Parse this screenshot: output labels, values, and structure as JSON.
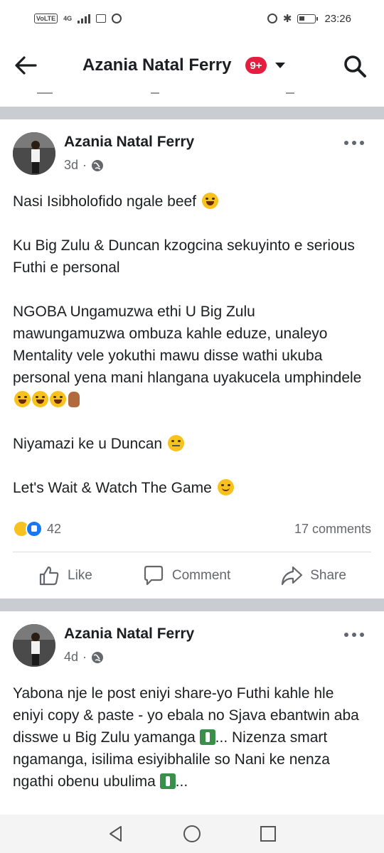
{
  "status_bar": {
    "network_label": "VoLTE",
    "signal_label": "4G",
    "time": "23:26"
  },
  "header": {
    "title": "Azania Natal Ferry",
    "notification_badge": "9+",
    "back_icon": "arrow-left-icon",
    "search_icon": "search-icon"
  },
  "posts": [
    {
      "author": "Azania Natal Ferry",
      "time": "3d",
      "dot": "·",
      "audience_icon": "globe-icon",
      "paragraphs": [
        "Nasi Isibholofido ngale beef",
        "Ku Big Zulu & Duncan kzogcina sekuyinto e serious Futhi e personal",
        "NGOBA Ungamuzwa ethi U Big Zulu mawungamuzwa ombuza kahle eduze, unaleyo Mentality vele yokuthi mawu disse wathi ukuba personal yena mani hlangana uyakucela umphindele",
        "Niyamazi ke u Duncan",
        "Let's Wait & Watch The Game"
      ],
      "reaction_count": "42",
      "comments": "17 comments",
      "actions": {
        "like": "Like",
        "comment": "Comment",
        "share": "Share"
      }
    },
    {
      "author": "Azania Natal Ferry",
      "time": "4d",
      "dot": "·",
      "audience_icon": "globe-icon",
      "text_1": "Yabona nje le post eniyi share-yo Futhi kahle hle eniyi copy & paste - yo ebala no Sjava ebantwin aba disswe u Big Zulu yamanga",
      "text_2": "... Nizenza smart ngamanga, isilima esiyibhalile so Nani ke nenza ngathi obenu ubulima",
      "text_3": "..."
    }
  ],
  "nav_bar": {
    "back_icon": "triangle-back-icon",
    "home_icon": "circle-home-icon",
    "recents_icon": "square-recents-icon"
  }
}
